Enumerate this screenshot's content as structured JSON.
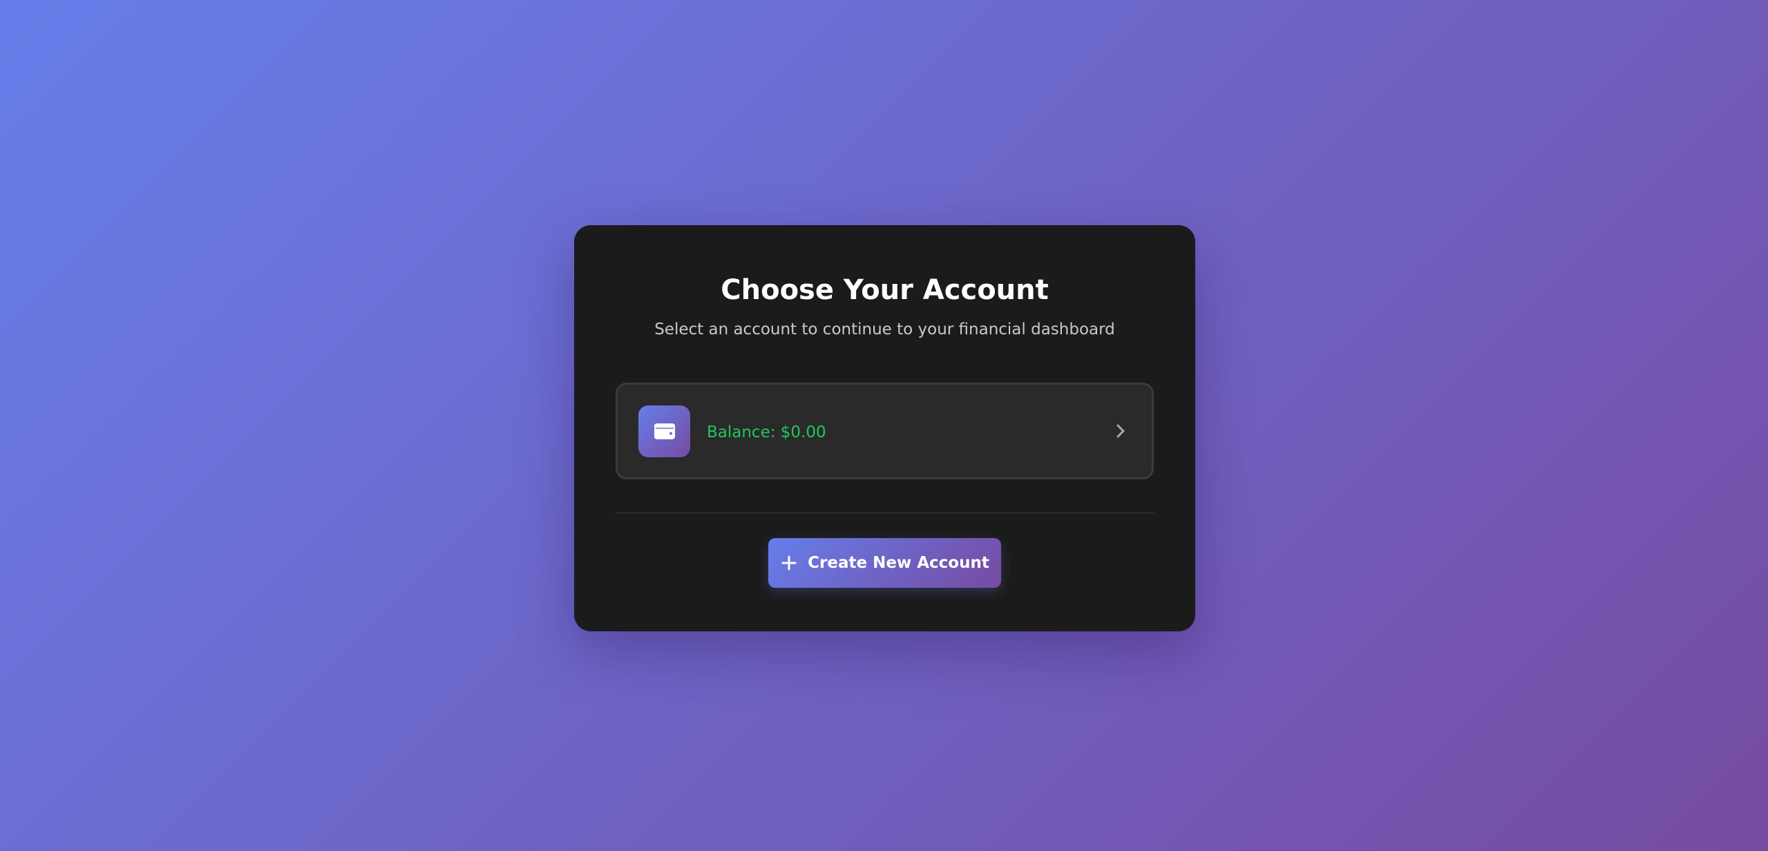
{
  "header": {
    "title": "Choose Your Account",
    "subtitle": "Select an account to continue to your financial dashboard"
  },
  "accounts": [
    {
      "icon": "wallet-icon",
      "balance_label": "Balance: $0.00",
      "action_icon": "chevron-right-icon"
    }
  ],
  "actions": {
    "create_label": "Create New Account",
    "create_icon": "plus-icon"
  },
  "colors": {
    "background_start": "#667eea",
    "background_end": "#764ba2",
    "card": "#1b1b1b",
    "account_item": "#2a2a2a",
    "balance_text": "#22c55e"
  }
}
